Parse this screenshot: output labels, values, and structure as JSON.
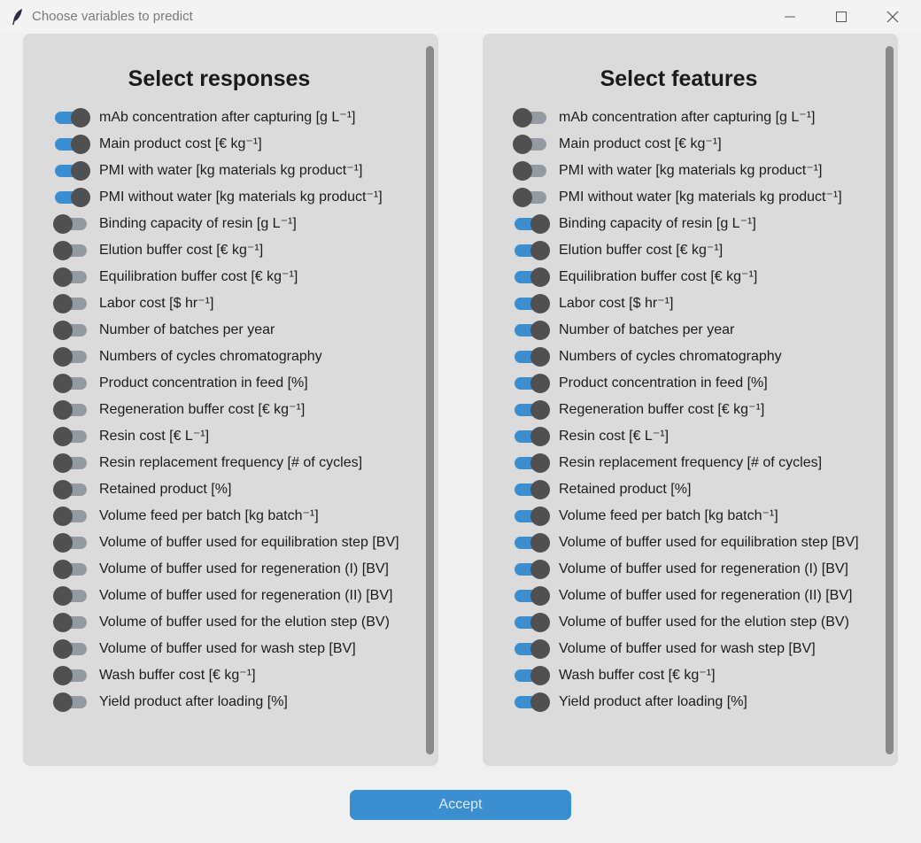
{
  "window": {
    "title": "Choose variables to predict"
  },
  "responses": {
    "title": "Select responses",
    "items": [
      {
        "label": "mAb concentration after capturing  [g L⁻¹]",
        "on": true
      },
      {
        "label": "Main product cost [€ kg⁻¹]",
        "on": true
      },
      {
        "label": "PMI with water [kg materials kg product⁻¹]",
        "on": true
      },
      {
        "label": "PMI without water [kg materials kg product⁻¹]",
        "on": true
      },
      {
        "label": "Binding capacity of resin [g L⁻¹]",
        "on": false
      },
      {
        "label": "Elution buffer cost [€ kg⁻¹]",
        "on": false
      },
      {
        "label": "Equilibration buffer cost [€ kg⁻¹]",
        "on": false
      },
      {
        "label": "Labor cost [$ hr⁻¹]",
        "on": false
      },
      {
        "label": "Number of batches per year",
        "on": false
      },
      {
        "label": "Numbers of cycles chromatography",
        "on": false
      },
      {
        "label": "Product concentration in feed [%]",
        "on": false
      },
      {
        "label": "Regeneration buffer cost [€ kg⁻¹]",
        "on": false
      },
      {
        "label": "Resin cost [€ L⁻¹]",
        "on": false
      },
      {
        "label": "Resin replacement frequency [# of cycles]",
        "on": false
      },
      {
        "label": "Retained product [%]",
        "on": false
      },
      {
        "label": "Volume feed per batch [kg batch⁻¹]",
        "on": false
      },
      {
        "label": "Volume of buffer used for equilibration step [BV]",
        "on": false
      },
      {
        "label": "Volume of buffer used for regeneration (I) [BV]",
        "on": false
      },
      {
        "label": "Volume of buffer used for regeneration (II) [BV]",
        "on": false
      },
      {
        "label": "Volume of buffer used for the elution step (BV)",
        "on": false
      },
      {
        "label": "Volume of buffer used for wash step [BV]",
        "on": false
      },
      {
        "label": "Wash buffer cost [€ kg⁻¹]",
        "on": false
      },
      {
        "label": "Yield product after loading [%]",
        "on": false
      }
    ]
  },
  "features": {
    "title": "Select features",
    "items": [
      {
        "label": "mAb concentration after capturing  [g L⁻¹]",
        "on": false
      },
      {
        "label": "Main product cost [€ kg⁻¹]",
        "on": false
      },
      {
        "label": "PMI with water [kg materials kg product⁻¹]",
        "on": false
      },
      {
        "label": "PMI without water [kg materials kg product⁻¹]",
        "on": false
      },
      {
        "label": "Binding capacity of resin [g L⁻¹]",
        "on": true
      },
      {
        "label": "Elution buffer cost [€ kg⁻¹]",
        "on": true
      },
      {
        "label": "Equilibration buffer cost [€ kg⁻¹]",
        "on": true
      },
      {
        "label": "Labor cost [$ hr⁻¹]",
        "on": true
      },
      {
        "label": "Number of batches per year",
        "on": true
      },
      {
        "label": "Numbers of cycles chromatography",
        "on": true
      },
      {
        "label": "Product concentration in feed [%]",
        "on": true
      },
      {
        "label": "Regeneration buffer cost [€ kg⁻¹]",
        "on": true
      },
      {
        "label": "Resin cost [€ L⁻¹]",
        "on": true
      },
      {
        "label": "Resin replacement frequency [# of cycles]",
        "on": true
      },
      {
        "label": "Retained product [%]",
        "on": true
      },
      {
        "label": "Volume feed per batch [kg batch⁻¹]",
        "on": true
      },
      {
        "label": "Volume of buffer used for equilibration step [BV]",
        "on": true
      },
      {
        "label": "Volume of buffer used for regeneration (I) [BV]",
        "on": true
      },
      {
        "label": "Volume of buffer used for regeneration (II) [BV]",
        "on": true
      },
      {
        "label": "Volume of buffer used for the elution step (BV)",
        "on": true
      },
      {
        "label": "Volume of buffer used for wash step [BV]",
        "on": true
      },
      {
        "label": "Wash buffer cost [€ kg⁻¹]",
        "on": true
      },
      {
        "label": "Yield product after loading [%]",
        "on": true
      }
    ]
  },
  "accept_label": "Accept",
  "colors": {
    "accent": "#3b8ed0",
    "switch_off_track": "#949aa1",
    "knob": "#505050",
    "panel": "#dbdbdb",
    "window": "#f0f0f0"
  },
  "icons": {
    "app": "feather-icon",
    "minimize": "minimize-icon",
    "maximize": "maximize-icon",
    "close": "close-icon"
  }
}
